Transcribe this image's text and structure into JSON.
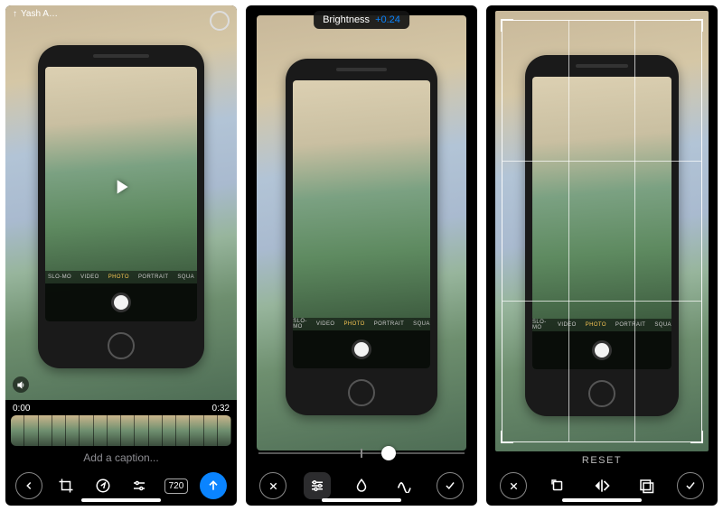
{
  "panel1": {
    "author_prefix": "↑",
    "author": "Yash A…",
    "time_start": "0:00",
    "time_end": "0:32",
    "caption_placeholder": "Add a caption...",
    "resolution": "720",
    "camera_modes": [
      "SLO-MO",
      "VIDEO",
      "PHOTO",
      "PORTRAIT",
      "SQUA"
    ]
  },
  "panel2": {
    "adjust_label": "Brightness",
    "adjust_value": "+0.24",
    "slider_pos_pct": 63,
    "camera_modes": [
      "SLO-MO",
      "VIDEO",
      "PHOTO",
      "PORTRAIT",
      "SQUA"
    ]
  },
  "panel3": {
    "reset_label": "RESET",
    "camera_modes": [
      "SLO-MO",
      "VIDEO",
      "PHOTO",
      "PORTRAIT",
      "SQUA"
    ]
  }
}
